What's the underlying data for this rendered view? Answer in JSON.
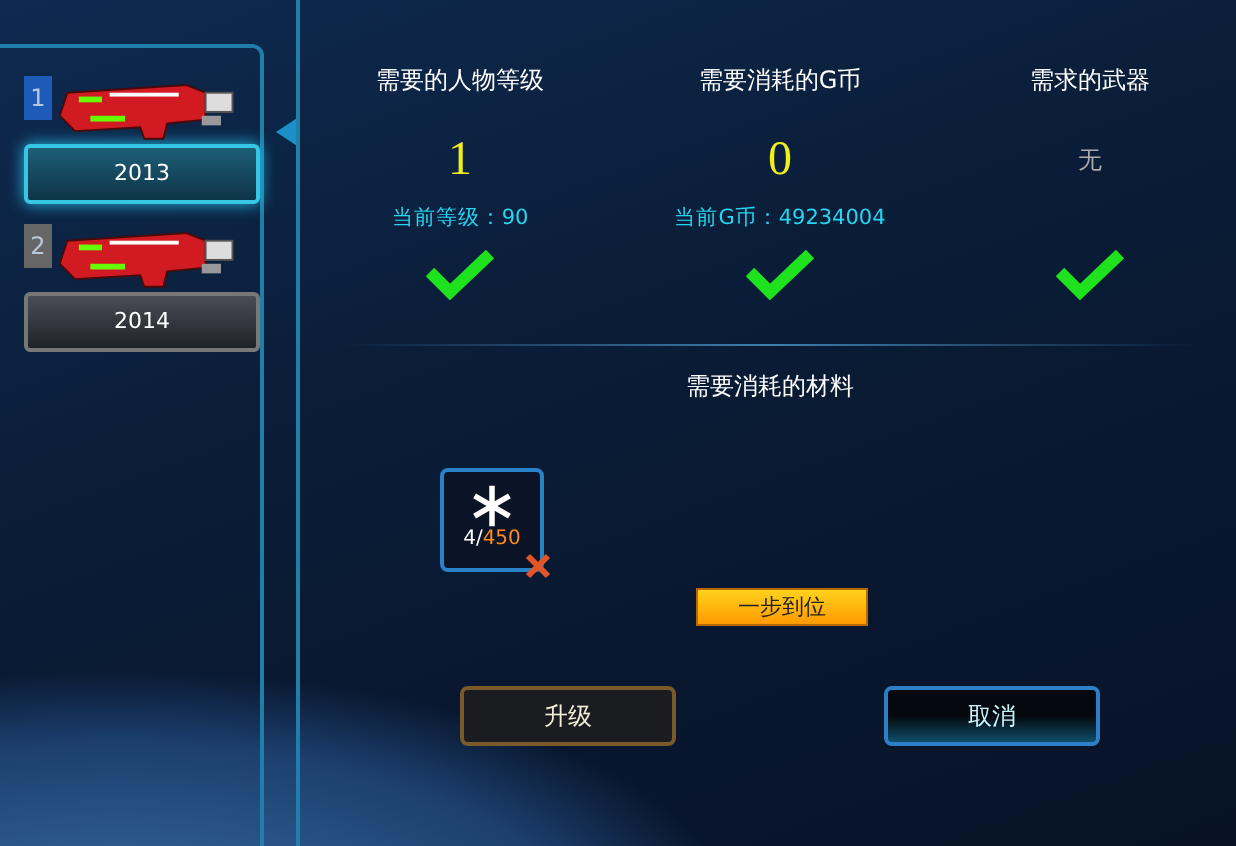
{
  "weapons": [
    {
      "index": "1",
      "year": "2013",
      "selected": true
    },
    {
      "index": "2",
      "year": "2014",
      "selected": false
    }
  ],
  "requirements": [
    {
      "title": "需要的人物等级",
      "value": "1",
      "kind": "number",
      "current": "当前等级：90",
      "met": true
    },
    {
      "title": "需要消耗的G币",
      "value": "0",
      "kind": "number",
      "current": "当前G币：49234004",
      "met": true
    },
    {
      "title": "需求的武器",
      "value": "无",
      "kind": "none",
      "met": true
    }
  ],
  "materials": {
    "title": "需要消耗的材料",
    "items": [
      {
        "have": "4/",
        "need": "450",
        "sufficient": false
      }
    ],
    "quick_button": "一步到位"
  },
  "buttons": [
    {
      "label": "升级",
      "kind": "upgrade"
    },
    {
      "label": "取消",
      "kind": "cancel"
    }
  ]
}
